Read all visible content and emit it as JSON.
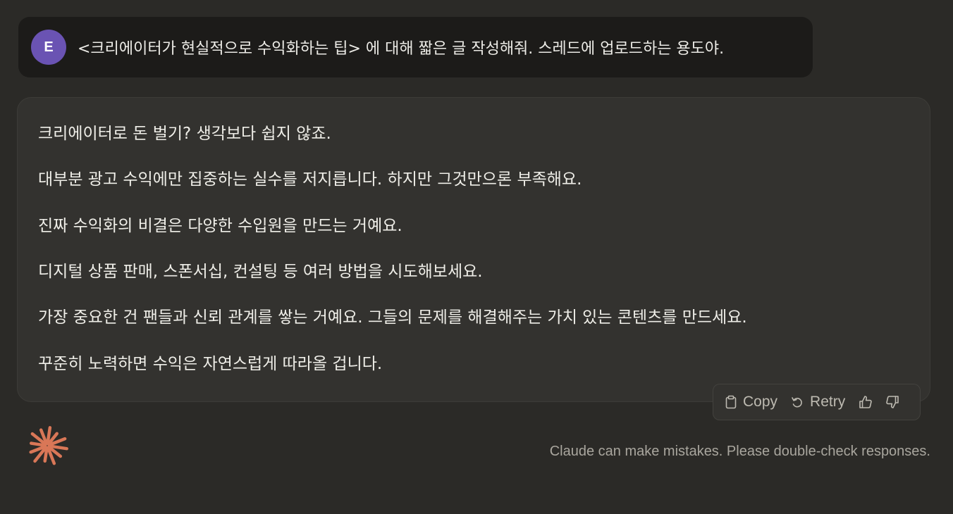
{
  "user_message": {
    "avatar_initial": "E",
    "avatar_color": "#6a53b3",
    "text": "<크리에이터가 현실적으로 수익화하는 팁> 에 대해 짧은 글 작성해줘. 스레드에 업로드하는 용도야."
  },
  "response": {
    "paragraphs": [
      "크리에이터로 돈 벌기? 생각보다 쉽지 않죠.",
      "대부분 광고 수익에만 집중하는 실수를 저지릅니다. 하지만 그것만으론 부족해요.",
      "진짜 수익화의 비결은 다양한 수입원을 만드는 거예요.",
      "디지털 상품 판매, 스폰서십, 컨설팅 등 여러 방법을 시도해보세요.",
      "가장 중요한 건 팬들과 신뢰 관계를 쌓는 거예요. 그들의 문제를 해결해주는 가치 있는 콘텐츠를 만드세요.",
      "꾸준히 노력하면 수익은 자연스럽게 따라올 겁니다."
    ]
  },
  "actions": {
    "copy_label": "Copy",
    "retry_label": "Retry",
    "icons": [
      "clipboard-icon",
      "retry-icon",
      "thumbs-up-icon",
      "thumbs-down-icon"
    ]
  },
  "footer": {
    "logo_icon": "claude-logo-icon",
    "logo_color": "#d97757",
    "disclaimer": "Claude can make mistakes. Please double-check responses."
  },
  "colors": {
    "background": "#2b2a27",
    "user_bubble": "#1c1b19",
    "response_card": "#33322f",
    "text": "#ecebe6"
  }
}
